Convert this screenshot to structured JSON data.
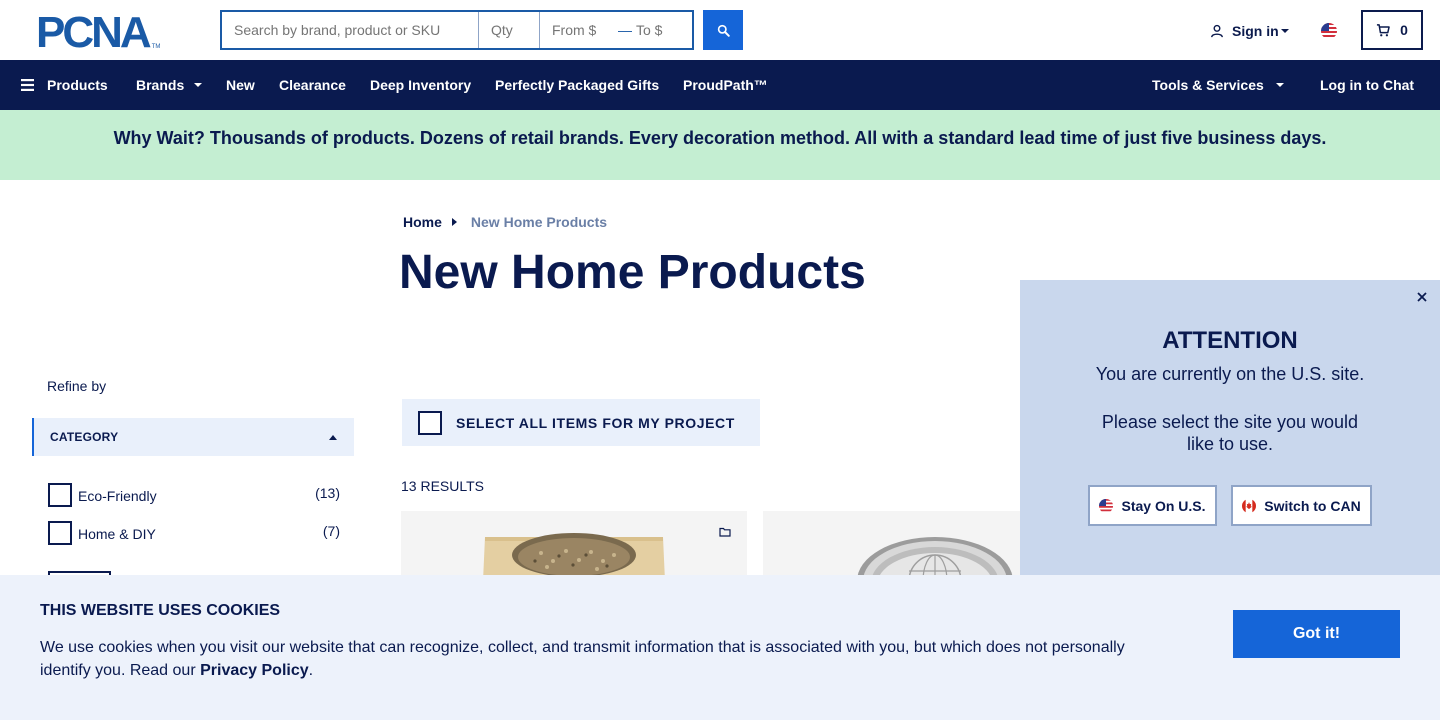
{
  "header": {
    "logo_text": "PCNA",
    "logo_tm": "TM",
    "search_placeholder": "Search by brand, product or SKU",
    "qty_placeholder": "Qty",
    "from_placeholder": "From $",
    "to_placeholder": "To $",
    "range_separator": "—",
    "signin_label": "Sign in",
    "cart_count": "0"
  },
  "nav": {
    "products": "Products",
    "brands": "Brands",
    "new": "New",
    "clearance": "Clearance",
    "deep_inventory": "Deep Inventory",
    "gifts": "Perfectly Packaged Gifts",
    "proudpath": "ProudPath™",
    "tools": "Tools & Services",
    "chat": "Log in to Chat"
  },
  "banner": {
    "text": "Why Wait? Thousands of products. Dozens of retail brands. Every decoration method. All with a standard lead time of just five business days."
  },
  "breadcrumb": {
    "home": "Home",
    "current": "New Home Products"
  },
  "page": {
    "title": "New Home Products",
    "select_all": "SELECT ALL ITEMS FOR MY PROJECT",
    "results": "13 RESULTS"
  },
  "sidebar": {
    "refine_label": "Refine by",
    "category_label": "CATEGORY",
    "filters": [
      {
        "label": "Eco-Friendly",
        "count": "(13)"
      },
      {
        "label": "Home & DIY",
        "count": "(7)"
      }
    ]
  },
  "popup": {
    "title": "ATTENTION",
    "line1": "You are currently on the U.S. site.",
    "line2": "Please select the site you would like to use.",
    "stay_label": "Stay On U.S.",
    "switch_label": "Switch to CAN"
  },
  "cookie": {
    "title": "THIS WEBSITE USES COOKIES",
    "text": "We use cookies when you visit our website that can recognize, collect, and transmit information that is associated with you, but which does not personally identify you. Read our",
    "link": "Privacy Policy",
    "period": ".",
    "button": "Got it!"
  },
  "colors": {
    "navy": "#0a1a4f",
    "accent_blue": "#1565d8",
    "banner_green": "#c4eed2",
    "popup_bg": "#c9d7ed",
    "cookie_bg": "#edf2fb"
  },
  "icons": [
    "search-icon",
    "user-icon",
    "us-flag-icon",
    "cart-icon",
    "menu-icon",
    "close-icon",
    "folder-icon",
    "canada-flag-icon"
  ]
}
